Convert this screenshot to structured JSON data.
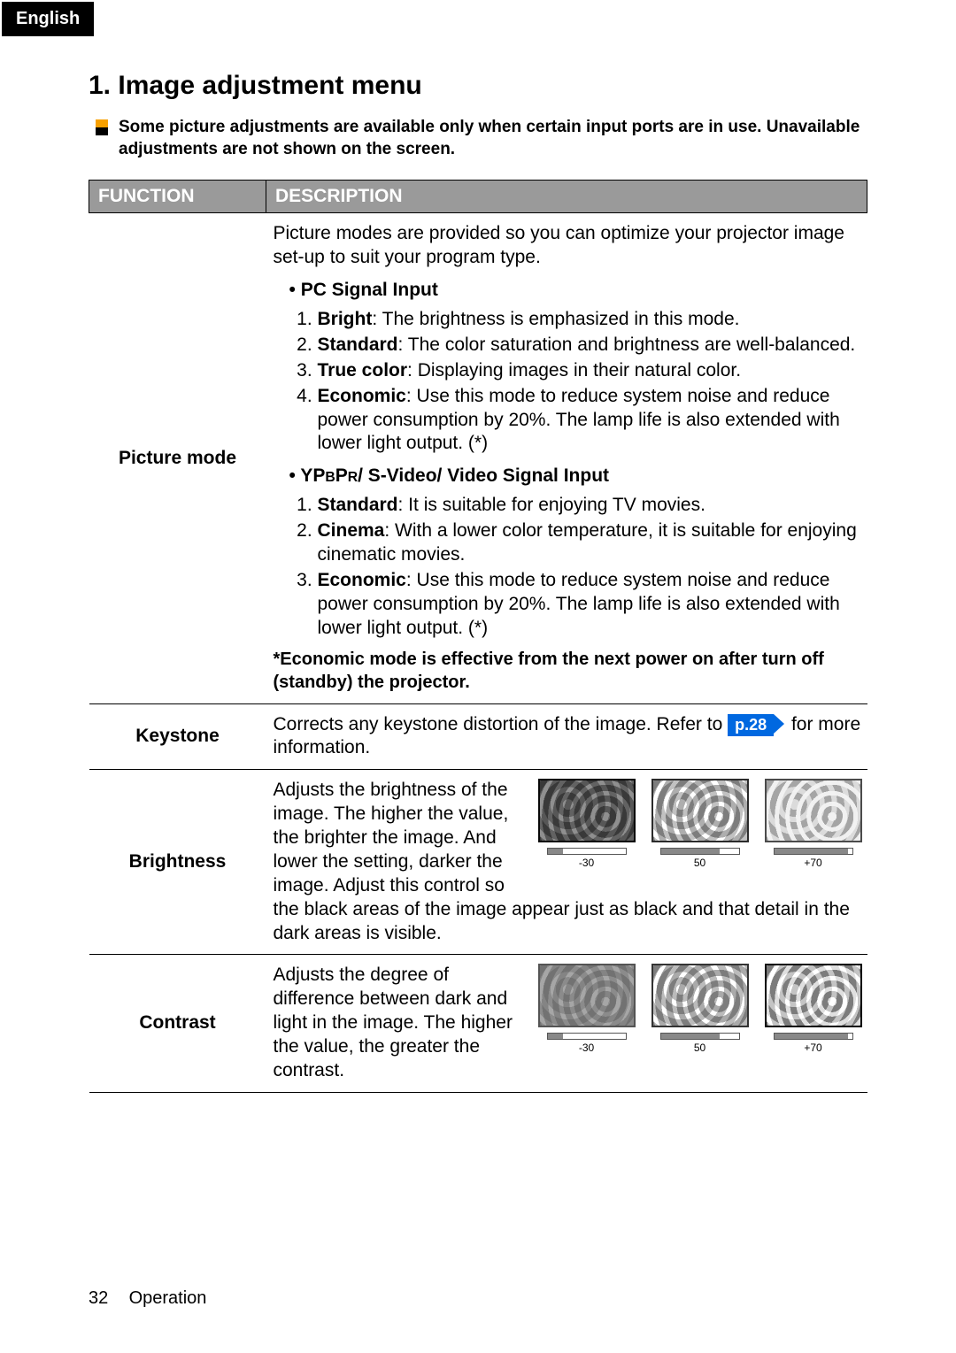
{
  "lang_tab": "English",
  "heading": "1. Image adjustment menu",
  "note": "Some picture adjustments are available only when certain input ports are in use. Unavailable adjustments are not shown on the screen.",
  "table": {
    "headers": {
      "function": "FUNCTION",
      "description": "DESCRIPTION"
    },
    "rows": {
      "picture_mode": {
        "name": "Picture mode",
        "intro": "Picture modes are provided so you can optimize your projector image set-up to suit your program type.",
        "group1_title": "PC Signal Input",
        "group1_items": [
          {
            "b": "Bright",
            "t": ": The brightness is emphasized in this mode."
          },
          {
            "b": "Standard",
            "t": ": The color saturation and brightness are well-balanced."
          },
          {
            "b": "True color",
            "t": ": Displaying images in their natural color."
          },
          {
            "b": "Economic",
            "t": ": Use this mode to reduce system noise and reduce power consumption by 20%. The lamp life is also extended with lower light output. (*)"
          }
        ],
        "group2_title_pre": "YP",
        "group2_title_sub1": "B",
        "group2_title_mid": "P",
        "group2_title_sub2": "R",
        "group2_title_post": "/ S-Video/ Video Signal Input",
        "group2_items": [
          {
            "b": "Standard",
            "t": ": It is suitable for enjoying TV movies."
          },
          {
            "b": "Cinema",
            "t": ": With a lower color temperature, it is suitable for enjoying cinematic movies."
          },
          {
            "b": "Economic",
            "t": ": Use this mode to reduce system noise and reduce power consumption by 20%. The lamp life is also extended with lower light output. (*)"
          }
        ],
        "footnote": "*Economic mode is effective from the next power on after turn off (standby) the projector."
      },
      "keystone": {
        "name": "Keystone",
        "t1": "Corrects any keystone distortion of the image. Refer to ",
        "pref": "p.28",
        "t2": " for more information."
      },
      "brightness": {
        "name": "Brightness",
        "text": "Adjusts the brightness of the image. The higher the value, the brighter the image. And lower the setting, darker the image. Adjust this control so the black areas of the image appear just as black and that detail in the dark areas is visible.",
        "sliders": [
          {
            "label": "-30",
            "fill_pct": 20
          },
          {
            "label": "50",
            "fill_pct": 75
          },
          {
            "label": "+70",
            "fill_pct": 95
          }
        ]
      },
      "contrast": {
        "name": "Contrast",
        "text": "Adjusts the degree of difference between dark and light in the image. The higher the value, the greater the contrast.",
        "sliders": [
          {
            "label": "-30",
            "fill_pct": 20
          },
          {
            "label": "50",
            "fill_pct": 75
          },
          {
            "label": "+70",
            "fill_pct": 95
          }
        ]
      }
    }
  },
  "footer": {
    "page": "32",
    "section": "Operation"
  }
}
